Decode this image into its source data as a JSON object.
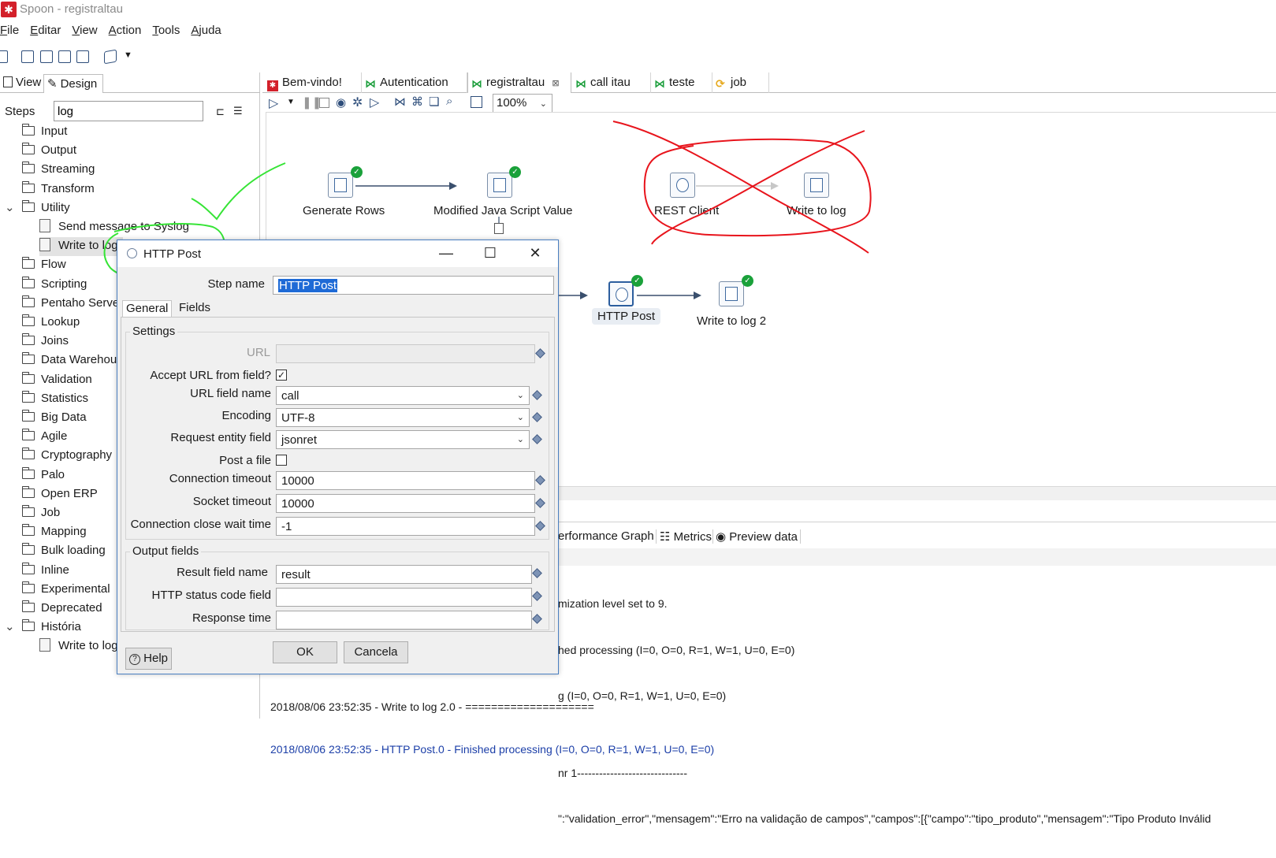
{
  "window": {
    "title": "Spoon - registraltau"
  },
  "menu": [
    "File",
    "Editar",
    "View",
    "Action",
    "Tools",
    "Ajuda"
  ],
  "left_panel": {
    "view_tab": "View",
    "design_tab": "Design",
    "steps_label": "Steps",
    "search_value": "log",
    "tree": [
      {
        "label": "Input"
      },
      {
        "label": "Output"
      },
      {
        "label": "Streaming"
      },
      {
        "label": "Transform"
      },
      {
        "label": "Utility",
        "expanded": true
      },
      {
        "label": "Send message to Syslog",
        "child": true
      },
      {
        "label": "Write to log",
        "child": true,
        "selected": true
      },
      {
        "label": "Flow"
      },
      {
        "label": "Scripting"
      },
      {
        "label": "Pentaho Server"
      },
      {
        "label": "Lookup"
      },
      {
        "label": "Joins"
      },
      {
        "label": "Data Warehouse"
      },
      {
        "label": "Validation"
      },
      {
        "label": "Statistics"
      },
      {
        "label": "Big Data"
      },
      {
        "label": "Agile"
      },
      {
        "label": "Cryptography"
      },
      {
        "label": "Palo"
      },
      {
        "label": "Open ERP"
      },
      {
        "label": "Job"
      },
      {
        "label": "Mapping"
      },
      {
        "label": "Bulk loading"
      },
      {
        "label": "Inline"
      },
      {
        "label": "Experimental"
      },
      {
        "label": "Deprecated"
      },
      {
        "label": "História",
        "expanded": true
      },
      {
        "label": "Write to log",
        "child": true
      }
    ]
  },
  "tabs": [
    {
      "label": "Bem-vindo!",
      "icon": "spoon-icon"
    },
    {
      "label": "Autentication",
      "icon": "transformation-icon"
    },
    {
      "label": "registraltau",
      "icon": "transformation-icon",
      "active": true
    },
    {
      "label": "call itau",
      "icon": "transformation-icon"
    },
    {
      "label": "teste",
      "icon": "transformation-icon"
    },
    {
      "label": "job",
      "icon": "job-icon"
    }
  ],
  "zoom": "100%",
  "canvas_nodes": [
    {
      "label": "Generate Rows"
    },
    {
      "label": "Modified Java Script Value"
    },
    {
      "label": "REST Client"
    },
    {
      "label": "Write to log"
    },
    {
      "label": "HTTP Post"
    },
    {
      "label": "Write to log 2"
    }
  ],
  "bottom_tabs": [
    "erformance Graph",
    "Metrics",
    "Preview data"
  ],
  "log_lines": [
    "mization level set to 9.",
    "hed processing (I=0, O=0, R=1, W=1, U=0, E=0)",
    "g (I=0, O=0, R=1, W=1, U=0, E=0)",
    "",
    "nr 1------------------------------",
    "\":\"validation_error\",\"mensagem\":\"Erro na validação de campos\",\"campos\":[{\"campo\":\"tipo_produto\",\"mensagem\":\"Tipo Produto Inválid"
  ],
  "log_lines_full": [
    "2018/08/06 23:52:35 - Write to log 2.0 - ====================",
    "2018/08/06 23:52:35 - HTTP Post.0 - Finished processing (I=0, O=0, R=1, W=1, U=0, E=0)"
  ],
  "dialog": {
    "title": "HTTP Post",
    "step_name_label": "Step name",
    "step_name_value": "HTTP Post",
    "tab_general": "General",
    "tab_fields": "Fields",
    "settings_group": "Settings",
    "url_label": "URL",
    "url_value": "",
    "accept_url_label": "Accept URL from field?",
    "accept_url_checked": true,
    "url_field_label": "URL field name",
    "url_field_value": "call",
    "encoding_label": "Encoding",
    "encoding_value": "UTF-8",
    "request_entity_label": "Request entity field",
    "request_entity_value": "jsonret",
    "post_file_label": "Post a file",
    "post_file_checked": false,
    "conn_timeout_label": "Connection timeout",
    "conn_timeout_value": "10000",
    "socket_timeout_label": "Socket timeout",
    "socket_timeout_value": "10000",
    "close_wait_label": "Connection close wait time",
    "close_wait_value": "-1",
    "output_group": "Output fields",
    "result_field_label": "Result field name",
    "result_field_value": "result",
    "status_code_label": "HTTP status code field",
    "status_code_value": "",
    "response_time_label": "Response time",
    "response_time_value": "",
    "ok_button": "OK",
    "cancel_button": "Cancela",
    "help_button": "Help"
  },
  "colors": {
    "annotation_green": "#36e436",
    "annotation_red": "#e8141c",
    "ok_badge": "#1aa13a",
    "selection_blue": "#1e6ad6"
  }
}
